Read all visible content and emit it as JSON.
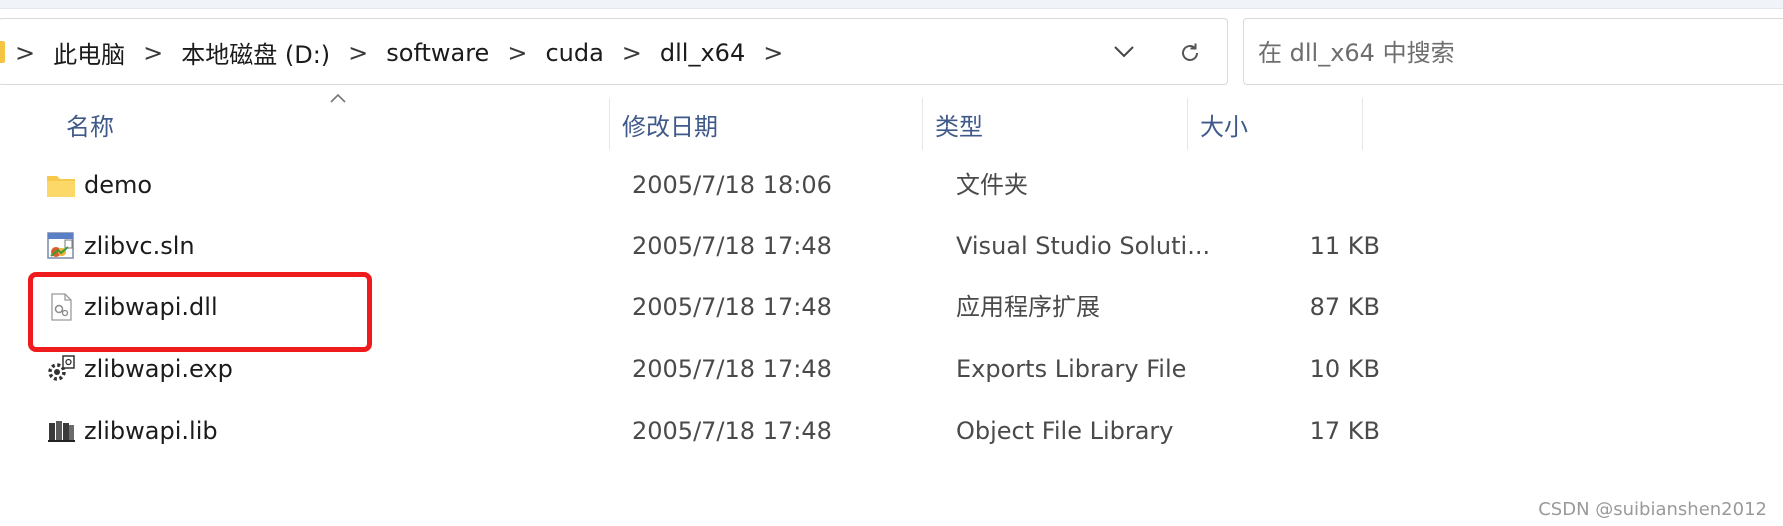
{
  "address": {
    "crumbs": [
      "此电脑",
      "本地磁盘 (D:)",
      "software",
      "cuda",
      "dll_x64"
    ],
    "separator": ">"
  },
  "search": {
    "placeholder": "在 dll_x64 中搜索"
  },
  "columns": {
    "name": "名称",
    "modified": "修改日期",
    "type": "类型",
    "size": "大小"
  },
  "files": [
    {
      "name": "demo",
      "modified": "2005/7/18 18:06",
      "type": "文件夹",
      "size": "",
      "icon": "folder-icon"
    },
    {
      "name": "zlibvc.sln",
      "modified": "2005/7/18 17:48",
      "type": "Visual Studio Soluti...",
      "size": "11 KB",
      "icon": "vs-solution-icon"
    },
    {
      "name": "zlibwapi.dll",
      "modified": "2005/7/18 17:48",
      "type": "应用程序扩展",
      "size": "87 KB",
      "icon": "dll-file-icon"
    },
    {
      "name": "zlibwapi.exp",
      "modified": "2005/7/18 17:48",
      "type": "Exports Library File",
      "size": "10 KB",
      "icon": "exp-file-icon"
    },
    {
      "name": "zlibwapi.lib",
      "modified": "2005/7/18 17:48",
      "type": "Object File Library",
      "size": "17 KB",
      "icon": "lib-file-icon"
    }
  ],
  "highlight": {
    "color": "#ee1c1c",
    "target": "zlibwapi.dll"
  },
  "watermark": "CSDN @suibianshen2012"
}
